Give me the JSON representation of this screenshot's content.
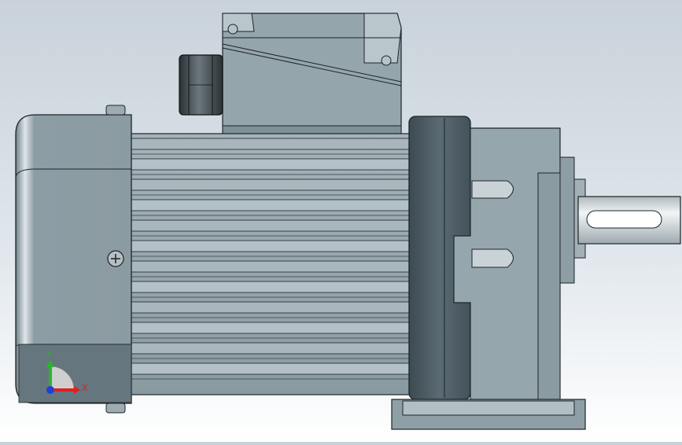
{
  "viewport": {
    "background_top": "#c9d2da",
    "background_bottom": "#ffffff"
  },
  "model": {
    "body_color": "#97a7ae",
    "dark_color": "#4a5a62",
    "outline_color": "#1d2427",
    "shaft_color": "#dde3e6"
  },
  "triad": {
    "x_label": "X",
    "y_label": "Y",
    "x_color": "#e02020",
    "y_color": "#2cb52c",
    "z_color": "#1f3fd6"
  }
}
